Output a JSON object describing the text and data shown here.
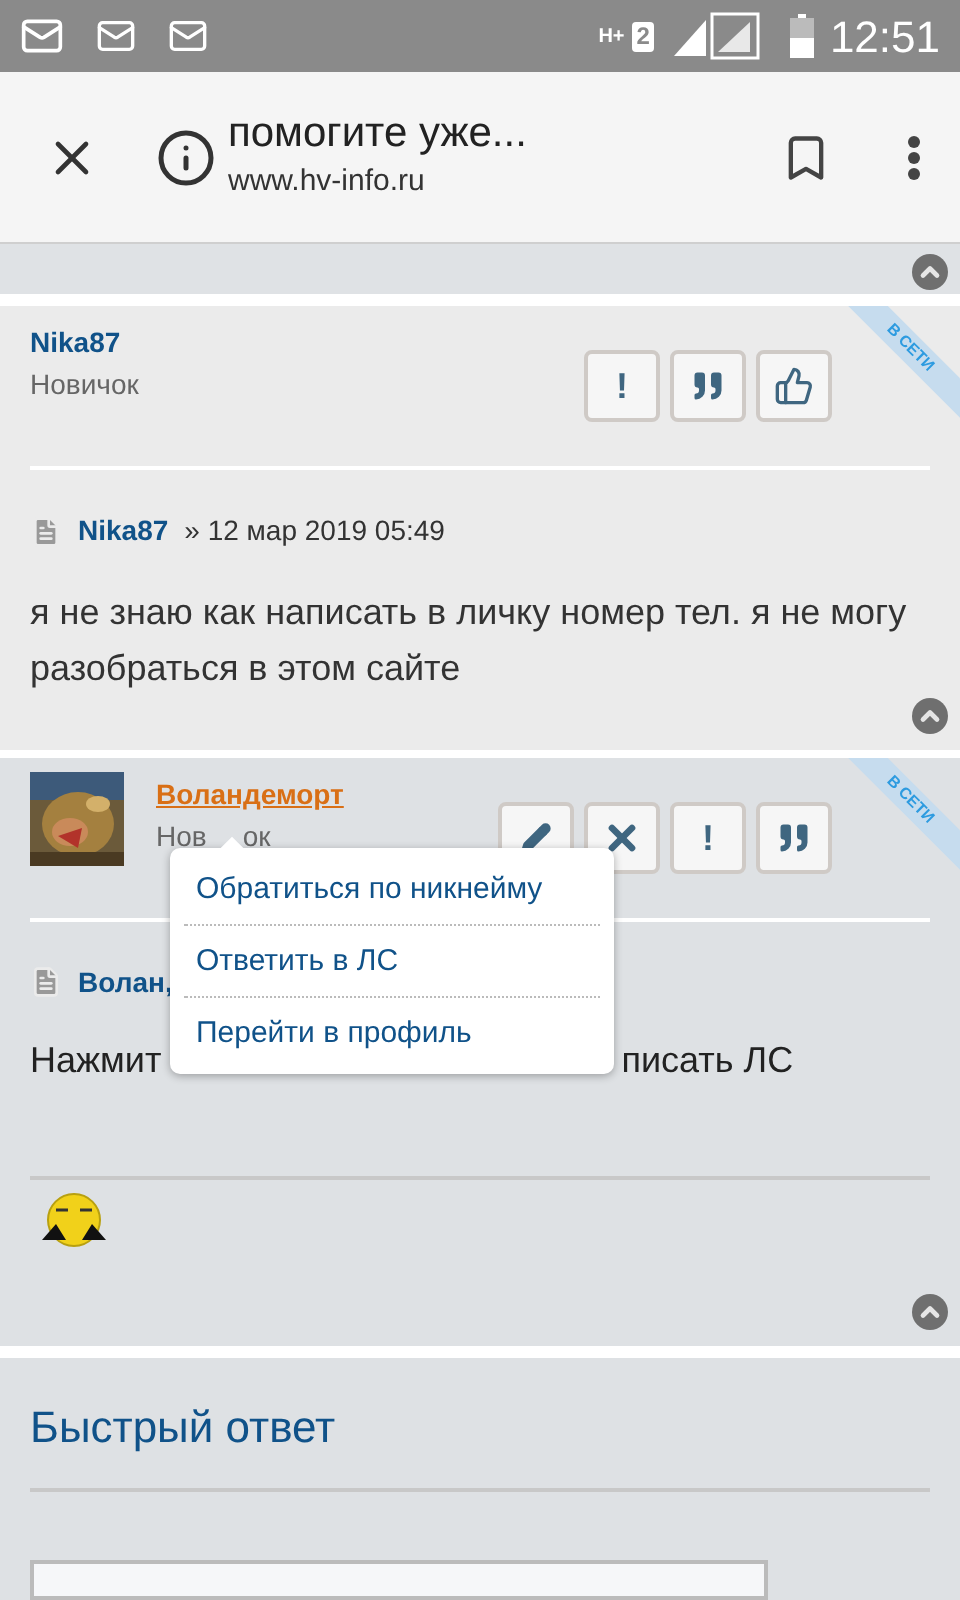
{
  "status_bar": {
    "time": "12:51",
    "network": "H+",
    "sim": "2"
  },
  "toolbar": {
    "title": "помогите уже...",
    "url": "www.hv-info.ru"
  },
  "posts": [
    {
      "author": "Nika87",
      "rank": "Новичок",
      "online_badge": "В СЕТИ",
      "avatar": false,
      "buttons": [
        {
          "kind": "report",
          "label": "!"
        },
        {
          "kind": "quote"
        },
        {
          "kind": "like"
        }
      ],
      "meta_author": "Nika87",
      "meta_date": "» 12 мар 2019 05:49",
      "body": [
        "я не знаю как написать в личку номер тел. я не могу разобраться в этом сайте"
      ],
      "signature": false
    },
    {
      "author": "Воландеморт",
      "rank": [
        "Нов",
        "ок"
      ],
      "online_badge": "В СЕТИ",
      "avatar": true,
      "buttons": [
        {
          "kind": "edit"
        },
        {
          "kind": "delete"
        },
        {
          "kind": "report",
          "label": "!"
        },
        {
          "kind": "quote"
        }
      ],
      "meta_author": "Волан,",
      "body": [
        "Нажмит",
        "писать ЛС"
      ],
      "signature": true
    }
  ],
  "popup_menu": [
    {
      "label": "Обратиться по никнейму"
    },
    {
      "label": "Ответить в ЛС"
    },
    {
      "label": "Перейти в профиль"
    }
  ],
  "quick_reply": {
    "title": "Быстрый ответ"
  }
}
